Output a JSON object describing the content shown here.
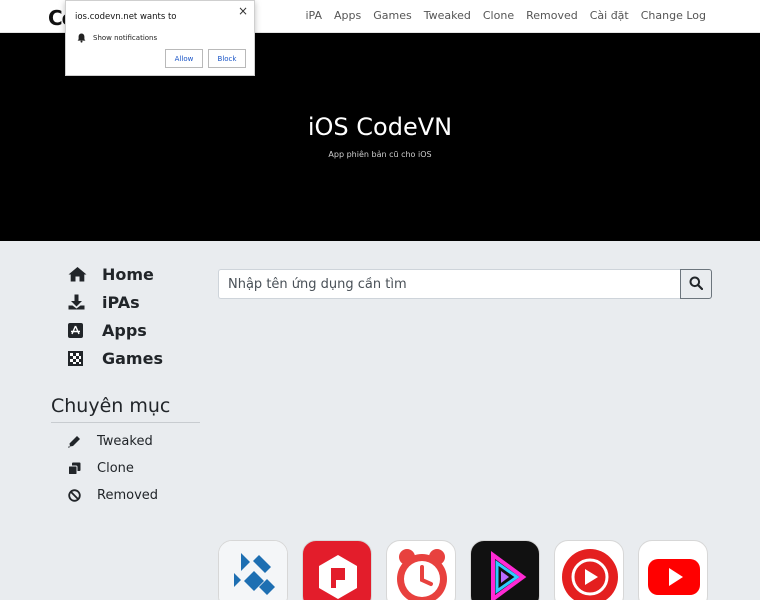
{
  "nav": {
    "logo": "Co",
    "links": [
      "iPA",
      "Apps",
      "Games",
      "Tweaked",
      "Clone",
      "Removed",
      "Cài đặt",
      "Change Log"
    ]
  },
  "notification": {
    "title": "ios.codevn.net wants to",
    "permission": "Show notifications",
    "allow_label": "Allow",
    "block_label": "Block",
    "close_glyph": "×"
  },
  "hero": {
    "title": "iOS CodeVN",
    "subtitle": "App phiên bản cũ cho iOS"
  },
  "sidebar": {
    "main": [
      {
        "label": "Home",
        "icon": "home-icon"
      },
      {
        "label": "iPAs",
        "icon": "download-icon"
      },
      {
        "label": "Apps",
        "icon": "app-store-icon"
      },
      {
        "label": "Games",
        "icon": "chess-board-icon"
      }
    ],
    "category_title": "Chuyên mục",
    "categories": [
      {
        "label": "Tweaked",
        "icon": "pen-icon"
      },
      {
        "label": "Clone",
        "icon": "copy-icon"
      },
      {
        "label": "Removed",
        "icon": "ban-icon"
      }
    ]
  },
  "search": {
    "placeholder": "Nhập tên ứng dụng cần tìm",
    "button_icon": "search-icon"
  },
  "apps": [
    {
      "name": "kodi-app-icon"
    },
    {
      "name": "pdf-app-icon"
    },
    {
      "name": "alarm-clock-app-icon"
    },
    {
      "name": "video-player-app-icon"
    },
    {
      "name": "music-play-app-icon"
    },
    {
      "name": "youtube-app-icon"
    }
  ],
  "colors": {
    "hero_bg": "#000000",
    "page_bg": "#e9ecef",
    "text": "#212529",
    "allow_blue": "#1a55c7"
  }
}
